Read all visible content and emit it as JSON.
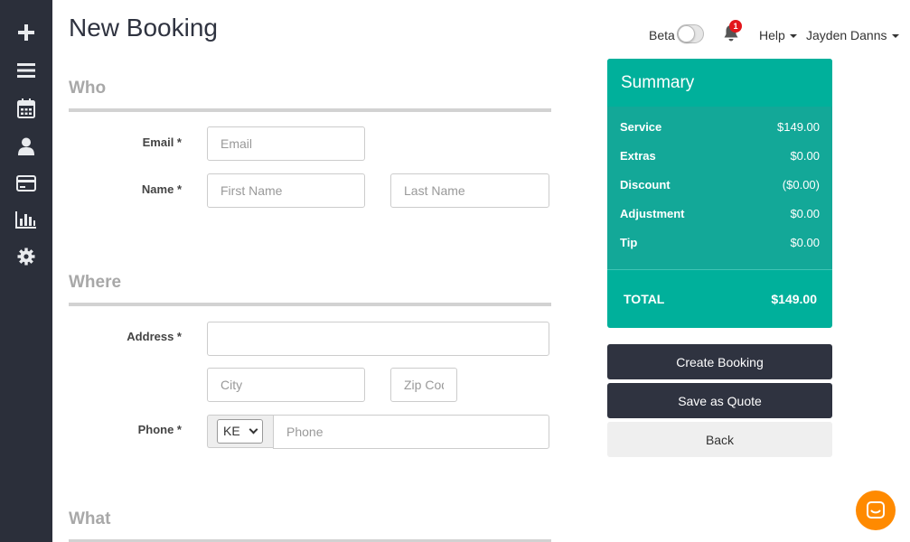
{
  "page": {
    "title": "New Booking"
  },
  "topbar": {
    "beta_label": "Beta",
    "beta_enabled": false,
    "notification_count": "1",
    "help_label": "Help",
    "user_name": "Jayden Danns"
  },
  "sidebar": {
    "items": [
      {
        "icon": "plus-icon"
      },
      {
        "icon": "menu-icon"
      },
      {
        "icon": "calendar-icon"
      },
      {
        "icon": "user-icon"
      },
      {
        "icon": "credit-card-icon"
      },
      {
        "icon": "bar-chart-icon"
      },
      {
        "icon": "gear-icon"
      }
    ]
  },
  "sections": {
    "who": "Who",
    "where": "Where",
    "what": "What"
  },
  "fields": {
    "email": {
      "label": "Email *",
      "placeholder": "Email",
      "value": ""
    },
    "name": {
      "label": "Name *",
      "first_placeholder": "First Name",
      "last_placeholder": "Last Name"
    },
    "address": {
      "label": "Address *",
      "value": ""
    },
    "city": {
      "placeholder": "City"
    },
    "zip": {
      "placeholder": "Zip Code"
    },
    "phone": {
      "label": "Phone *",
      "country": "KE",
      "placeholder": "Phone"
    }
  },
  "summary": {
    "title": "Summary",
    "rows": [
      {
        "label": "Service",
        "value": "$149.00"
      },
      {
        "label": "Extras",
        "value": "$0.00"
      },
      {
        "label": "Discount",
        "value": "($0.00)"
      },
      {
        "label": "Adjustment",
        "value": "$0.00"
      },
      {
        "label": "Tip",
        "value": "$0.00"
      }
    ],
    "total_label": "TOTAL",
    "total_value": "$149.00"
  },
  "actions": {
    "create": "Create Booking",
    "quote": "Save as Quote",
    "back": "Back"
  },
  "colors": {
    "sidebar": "#2b2f3a",
    "accent": "#00b09b",
    "dark_button": "#2f3340",
    "chat": "#ff8a00",
    "badge": "#e3161b"
  }
}
